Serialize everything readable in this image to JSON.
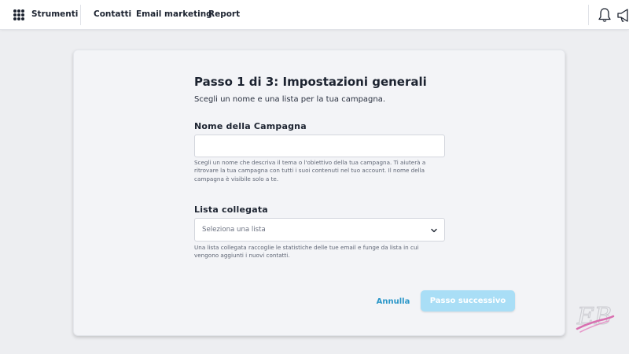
{
  "topbar": {
    "apps_icon": "grid-dots-icon",
    "tools_label": "Strumenti",
    "nav": [
      "Contatti",
      "Email marketing",
      "Report"
    ],
    "right_icons": [
      "bell-icon",
      "megaphone-icon"
    ]
  },
  "form": {
    "title": "Passo 1 di 3: Impostazioni generali",
    "subtitle": "Scegli un nome e una lista per la tua campagna.",
    "campaign_name": {
      "label": "Nome della Campagna",
      "value": "",
      "help": "Scegli un nome che descriva il tema o l'obiettivo della tua campagna. Ti aiuterà a ritrovare la tua campagna con tutti i suoi contenuti nel tuo account. Il nome della campagna è visibile solo a te."
    },
    "linked_list": {
      "label": "Lista collegata",
      "placeholder": "Seleziona una lista",
      "help": "Una lista collegata raccoglie le statistiche delle tue email e funge da lista in cui vengono aggiunti i nuovi contatti."
    },
    "actions": {
      "cancel": "Annulla",
      "next": "Passo successivo"
    }
  },
  "colors": {
    "accent": "#2a96c8",
    "next_disabled": "#a9def6",
    "watermark": "#d96fb0"
  },
  "watermark": {
    "text": "EB"
  }
}
